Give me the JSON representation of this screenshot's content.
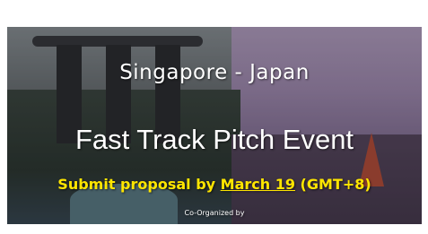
{
  "banner": {
    "line1": "Singapore - Japan",
    "line2": "Fast Track Pitch Event",
    "line3_before": "Submit proposal by ",
    "line3_date": "March 19",
    "line3_after": " (GMT+8)",
    "line4": "Co-Organized by"
  },
  "colors": {
    "headline_text": "#ffffff",
    "deadline_text": "#ffe600"
  }
}
